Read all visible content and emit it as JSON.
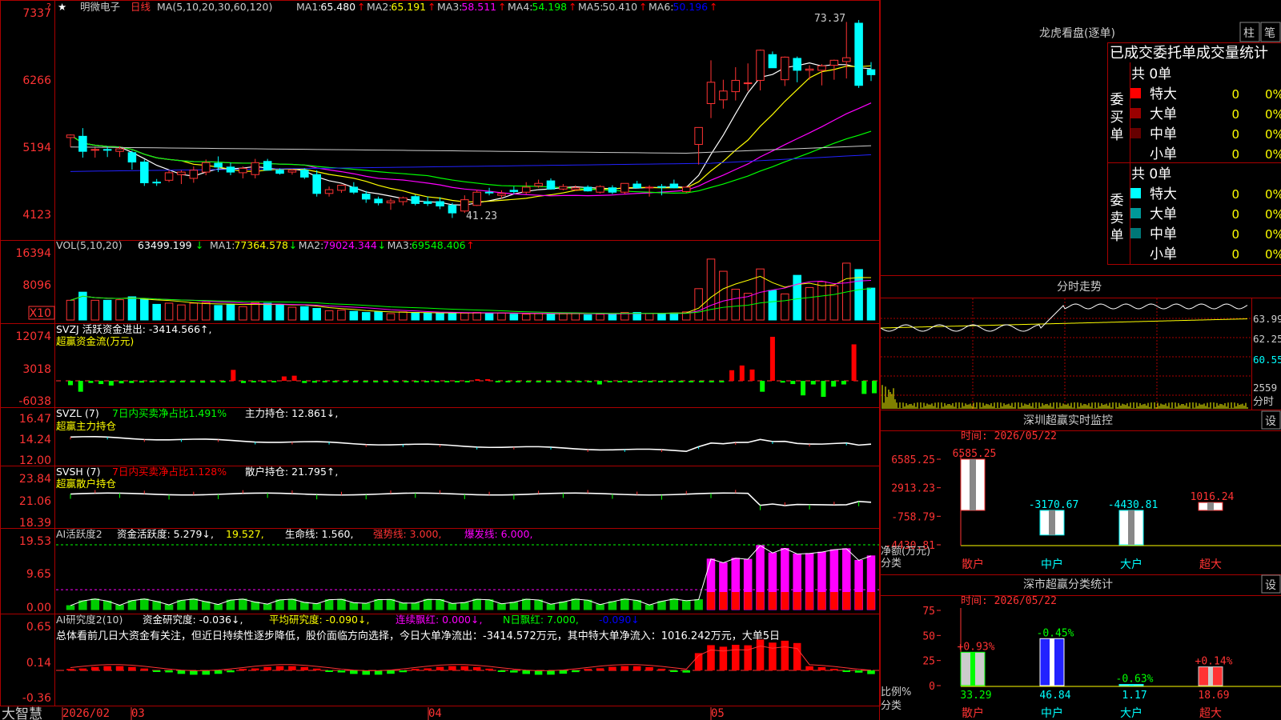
{
  "stock": {
    "name": "明微电子",
    "period": "日线",
    "star": "★"
  },
  "ma_header": {
    "params": "MA(5,10,20,30,60,120)",
    "items": [
      {
        "label": "MA1:",
        "value": "65.480",
        "arrow": "↑",
        "color": "#ffffff"
      },
      {
        "label": "MA2:",
        "value": "65.191",
        "arrow": "↑",
        "color": "#ffff00"
      },
      {
        "label": "MA3:",
        "value": "58.511",
        "arrow": "↑",
        "color": "#ff00ff"
      },
      {
        "label": "MA4:",
        "value": "54.198",
        "arrow": "↑",
        "color": "#00ff00"
      },
      {
        "label": "MA5:",
        "value": "50.410",
        "arrow": "↑",
        "color": "#cccccc"
      },
      {
        "label": "MA6:",
        "value": "50.196",
        "arrow": "↑",
        "color": "#0000ff"
      }
    ]
  },
  "vol_header": {
    "params": "VOL(5,10,20)",
    "current": "63499.199",
    "current_arrow": "↓",
    "items": [
      {
        "label": "MA1:",
        "value": "77364.578",
        "arrow": "↓",
        "color": "#ffff00"
      },
      {
        "label": "MA2:",
        "value": "79024.344",
        "arrow": "↓",
        "color": "#ff00ff"
      },
      {
        "label": "MA3:",
        "value": "69548.406",
        "arrow": "↑",
        "color": "#00ff00"
      }
    ]
  },
  "svzj_header": {
    "line1": "SVZJ  活跃资金进出: -3414.566↑,",
    "line2": "超赢资金流(万元)"
  },
  "svzl_header": {
    "name": "SVZL  (7)",
    "ratio": "7日内买卖净占比1.491%",
    "holding": "主力持仓: 12.861↓,",
    "line2": "超赢主力持仓"
  },
  "svsh_header": {
    "name": "SVSH  (7)",
    "ratio": "7日内买卖净占比1.128%",
    "holding": "散户持仓: 21.795↑,",
    "line2": "超赢散户持仓"
  },
  "ai_header": {
    "name": "AI活跃度2",
    "a": "资金活跃度: 5.279↓,",
    "b": "19.527,",
    "c": "生命线: 1.560,",
    "d": "强势线: 3.000,",
    "e": "爆发线: 6.000,"
  },
  "research_header": {
    "name": "AI研究度2(10)",
    "a": "资金研究度: -0.036↓,",
    "b": "平均研究度: -0.090↓,",
    "c": "连续飘红: 0.000↓,",
    "d": "N日飘红: 7.000,",
    "e": "-0.090↓",
    "comment": "总体看前几日大资金有关注，但近日持续性逐步降低，股价面临方向选择，今日大单净流出：-3414.572万元，其中特大单净流入：1016.242万元，大单5日"
  },
  "price_axis": [
    "7337",
    "6266",
    "5194",
    "4123"
  ],
  "vol_axis": [
    "16394",
    "8096",
    "X10"
  ],
  "flow_axis": [
    "12074",
    "3018",
    "-6038"
  ],
  "zl_axis": [
    "16.47",
    "14.24",
    "12.00"
  ],
  "sh_axis": [
    "23.84",
    "21.06",
    "18.39"
  ],
  "ai_axis": [
    "19.53",
    "9.65",
    "0.00"
  ],
  "rs_axis": [
    "0.65",
    "0.14",
    "-0.36"
  ],
  "high_label": "73.37",
  "low_label": "41.23",
  "bottom_bar": {
    "brand": "大智慧",
    "dates": [
      "2026/02",
      "03",
      "04",
      "05"
    ]
  },
  "lhb": {
    "title": "龙虎看盘(逐单)",
    "btn1": "柱",
    "btn2": "笔",
    "header": "已成交委托单成交量统计",
    "buy_label": "委买单",
    "sell_label": "委卖单",
    "buy_total": "共 0单",
    "sell_total": "共 0单",
    "buy_rows": [
      {
        "name": "特大",
        "v": "0",
        "p": "0%",
        "color": "#ff0000"
      },
      {
        "name": "大单",
        "v": "0",
        "p": "0%",
        "color": "#990000"
      },
      {
        "name": "中单",
        "v": "0",
        "p": "0%",
        "color": "#660000"
      },
      {
        "name": "小单",
        "v": "0",
        "p": "0%",
        "color": ""
      }
    ],
    "sell_rows": [
      {
        "name": "特大",
        "v": "0",
        "p": "0%",
        "color": "#00ffff"
      },
      {
        "name": "大单",
        "v": "0",
        "p": "0%",
        "color": "#009999"
      },
      {
        "name": "中单",
        "v": "0",
        "p": "0%",
        "color": "#007777"
      },
      {
        "name": "小单",
        "v": "0",
        "p": "0%",
        "color": ""
      }
    ]
  },
  "intraday": {
    "title": "分时走势",
    "axis": [
      "63.99",
      "62.25",
      "60.55",
      "2559",
      "分时"
    ]
  },
  "monitor": {
    "title": "深圳超赢实时监控",
    "btn": "设",
    "time": "时间: 2026/05/22",
    "axis": [
      "6585.25",
      "2913.23",
      "-758.79",
      "-4430.81"
    ],
    "net_label": "净额(万元)",
    "cat_label": "分类",
    "cats": [
      "散户",
      "中户",
      "大户",
      "超大"
    ],
    "values": [
      "6585.25",
      "-3170.67",
      "-4430.81",
      "1016.24"
    ]
  },
  "stats": {
    "title": "深市超赢分类统计",
    "btn": "设",
    "time": "时间: 2026/05/22",
    "axis": [
      "75",
      "50",
      "25",
      "0"
    ],
    "ratio_label": "比例%",
    "cat_label": "分类",
    "cats": [
      "散户",
      "中户",
      "大户",
      "超大"
    ],
    "changes": [
      "+0.93%",
      "-0.45%",
      "-0.63%",
      "+0.14%"
    ],
    "values": [
      "33.29",
      "46.84",
      "1.17",
      "18.69"
    ]
  },
  "chart_data": {
    "type": "candlestick",
    "ylim": [
      41.23,
      73.37
    ],
    "candles": [
      [
        54.0,
        54.5,
        52.5,
        54.4
      ],
      [
        54.2,
        55.5,
        50.8,
        51.8
      ],
      [
        52.0,
        52.4,
        50.8,
        52.1
      ],
      [
        52.1,
        52.6,
        50.9,
        52.0
      ],
      [
        51.8,
        52.6,
        50.9,
        52.2
      ],
      [
        51.6,
        51.9,
        48.9,
        50.1
      ],
      [
        50.1,
        50.5,
        46.3,
        46.8
      ],
      [
        46.9,
        47.4,
        46.3,
        46.8
      ],
      [
        47.2,
        48.8,
        46.9,
        48.4
      ],
      [
        48.1,
        48.8,
        46.6,
        48.5
      ],
      [
        47.5,
        49.4,
        46.8,
        48.8
      ],
      [
        48.5,
        50.5,
        48.0,
        50.0
      ],
      [
        49.9,
        51.0,
        48.5,
        49.3
      ],
      [
        49.3,
        50.0,
        48.0,
        48.5
      ],
      [
        48.4,
        49.4,
        47.5,
        49.1
      ],
      [
        48.1,
        50.6,
        47.5,
        50.0
      ],
      [
        50.2,
        50.6,
        48.8,
        48.8
      ],
      [
        48.8,
        49.1,
        48.1,
        48.3
      ],
      [
        48.5,
        49.0,
        48.1,
        48.8
      ],
      [
        48.8,
        49.1,
        47.4,
        47.7
      ],
      [
        48.1,
        48.8,
        44.6,
        45.1
      ],
      [
        45.1,
        46.2,
        44.6,
        45.7
      ],
      [
        45.6,
        46.5,
        45.2,
        46.4
      ],
      [
        46.1,
        46.9,
        45.0,
        45.3
      ],
      [
        45.0,
        45.5,
        43.6,
        44.2
      ],
      [
        44.2,
        44.6,
        43.2,
        43.6
      ],
      [
        43.6,
        44.3,
        42.5,
        43.9
      ],
      [
        43.8,
        44.6,
        43.2,
        44.4
      ],
      [
        44.6,
        44.9,
        43.2,
        43.5
      ],
      [
        43.8,
        44.6,
        43.1,
        43.5
      ],
      [
        43.8,
        44.5,
        42.6,
        43.1
      ],
      [
        43.2,
        43.6,
        41.2,
        42.0
      ],
      [
        42.3,
        44.8,
        42.0,
        44.1
      ],
      [
        43.2,
        45.7,
        43.1,
        45.3
      ],
      [
        45.3,
        46.0,
        44.8,
        45.2
      ],
      [
        44.8,
        45.6,
        44.3,
        45.1
      ],
      [
        45.6,
        46.2,
        45.0,
        45.4
      ],
      [
        45.3,
        46.9,
        45.0,
        46.1
      ],
      [
        46.3,
        47.3,
        46.0,
        46.7
      ],
      [
        47.1,
        47.5,
        45.7,
        45.8
      ],
      [
        45.8,
        46.6,
        45.6,
        46.2
      ],
      [
        45.7,
        46.4,
        45.5,
        46.0
      ],
      [
        46.1,
        46.4,
        45.4,
        45.5
      ],
      [
        45.3,
        46.4,
        45.1,
        46.2
      ],
      [
        46.0,
        46.4,
        45.0,
        45.3
      ],
      [
        45.3,
        46.6,
        45.0,
        46.7
      ],
      [
        46.6,
        47.1,
        45.9,
        46.0
      ],
      [
        46.0,
        46.4,
        44.6,
        46.1
      ],
      [
        46.2,
        46.6,
        44.8,
        46.1
      ],
      [
        46.6,
        47.3,
        45.9,
        46.0
      ],
      [
        45.4,
        46.3,
        45.2,
        46.1
      ],
      [
        52.9,
        55.0,
        49.7,
        55.6
      ],
      [
        59.4,
        66.3,
        57.1,
        62.8
      ],
      [
        60.0,
        63.2,
        58.6,
        61.4
      ],
      [
        61.3,
        65.2,
        59.9,
        63.1
      ],
      [
        62.6,
        65.8,
        61.4,
        62.7
      ],
      [
        63.1,
        68.0,
        61.5,
        67.9
      ],
      [
        67.2,
        67.7,
        65.1,
        65.1
      ],
      [
        63.2,
        66.9,
        62.2,
        66.8
      ],
      [
        66.6,
        66.9,
        62.8,
        64.7
      ],
      [
        64.7,
        65.5,
        63.2,
        64.9
      ],
      [
        64.7,
        65.7,
        62.3,
        65.4
      ],
      [
        65.5,
        66.4,
        63.2,
        66.3
      ],
      [
        66.1,
        72.4,
        63.4,
        66.7
      ],
      [
        72.2,
        72.7,
        61.9,
        62.3
      ],
      [
        64.8,
        66.0,
        63.0,
        64.0
      ]
    ],
    "volumes": [
      3400,
      4800,
      3400,
      3400,
      3500,
      4000,
      3700,
      2700,
      2900,
      2600,
      2900,
      3000,
      2500,
      2700,
      2300,
      3000,
      2900,
      2600,
      2200,
      2300,
      2000,
      1600,
      1700,
      1500,
      1300,
      1400,
      1100,
      1400,
      1300,
      1200,
      1100,
      1200,
      1200,
      1300,
      1200,
      1200,
      1000,
      1000,
      1100,
      1100,
      1200,
      1200,
      900,
      1000,
      1000,
      1300,
      1300,
      1100,
      1100,
      1200,
      1400,
      5400,
      10500,
      8400,
      5300,
      4600,
      8800,
      5100,
      4500,
      7700,
      5600,
      6600,
      5900,
      9800,
      8700,
      5500
    ],
    "flows": [
      -1200,
      -3000,
      -600,
      -900,
      -1300,
      -700,
      -600,
      -500,
      -100,
      -350,
      -500,
      -300,
      -100,
      -500,
      -50,
      -400,
      3000,
      -600,
      -450,
      -500,
      -100,
      1200,
      1400,
      -600,
      -500,
      -200,
      -300,
      -400,
      -300,
      -400,
      -300,
      -250,
      -300,
      -200,
      -300,
      -300,
      -300,
      -150,
      -150,
      -150,
      150,
      300,
      -300,
      -200,
      -250,
      -300,
      -50,
      -250,
      -400,
      -250,
      -300,
      -200,
      -1000,
      -150,
      -300,
      -500,
      -350,
      -300,
      -150,
      -300,
      -200,
      -200,
      -100,
      -250,
      -100,
      2900,
      4200,
      3100,
      -3000,
      12074,
      -500,
      -900,
      -4000,
      -1000,
      -4400,
      -1600,
      -1000,
      10000,
      -3600,
      -3414
    ]
  }
}
